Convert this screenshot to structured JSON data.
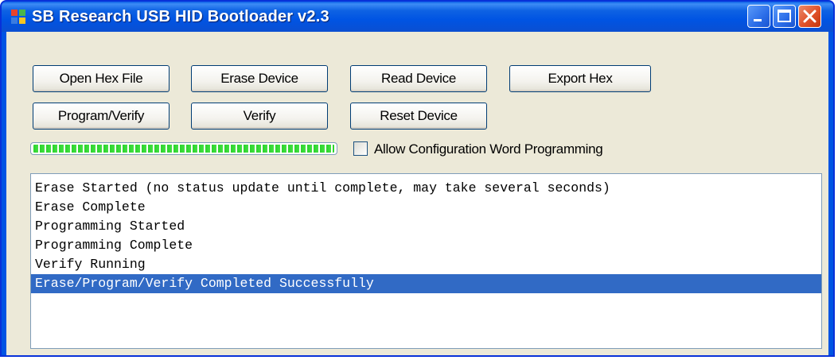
{
  "window": {
    "title": "SB Research USB HID Bootloader v2.3"
  },
  "icons": {
    "app": "application-icon",
    "minimize": "minimize-icon",
    "maximize": "maximize-icon",
    "close": "close-icon"
  },
  "buttons": {
    "open_hex_file": "Open Hex File",
    "erase_device": "Erase Device",
    "read_device": "Read Device",
    "export_hex": "Export Hex",
    "program_verify": "Program/Verify",
    "verify": "Verify",
    "reset_device": "Reset Device"
  },
  "progress": {
    "value_percent": 100
  },
  "options": {
    "allow_config_label": "Allow Configuration Word Programming",
    "allow_config_checked": false
  },
  "log": {
    "lines": [
      "Erase Started (no status update until complete, may take several seconds)",
      "Erase Complete",
      "Programming Started",
      "Programming Complete",
      "Verify Running",
      "Erase/Program/Verify Completed Successfully"
    ],
    "selected_index": 5
  },
  "colors": {
    "title_bar": "#0054e3",
    "client_bg": "#ece9d8",
    "selection": "#316ac5",
    "progress_fill": "#2bd32b",
    "close_button": "#e0512a"
  }
}
